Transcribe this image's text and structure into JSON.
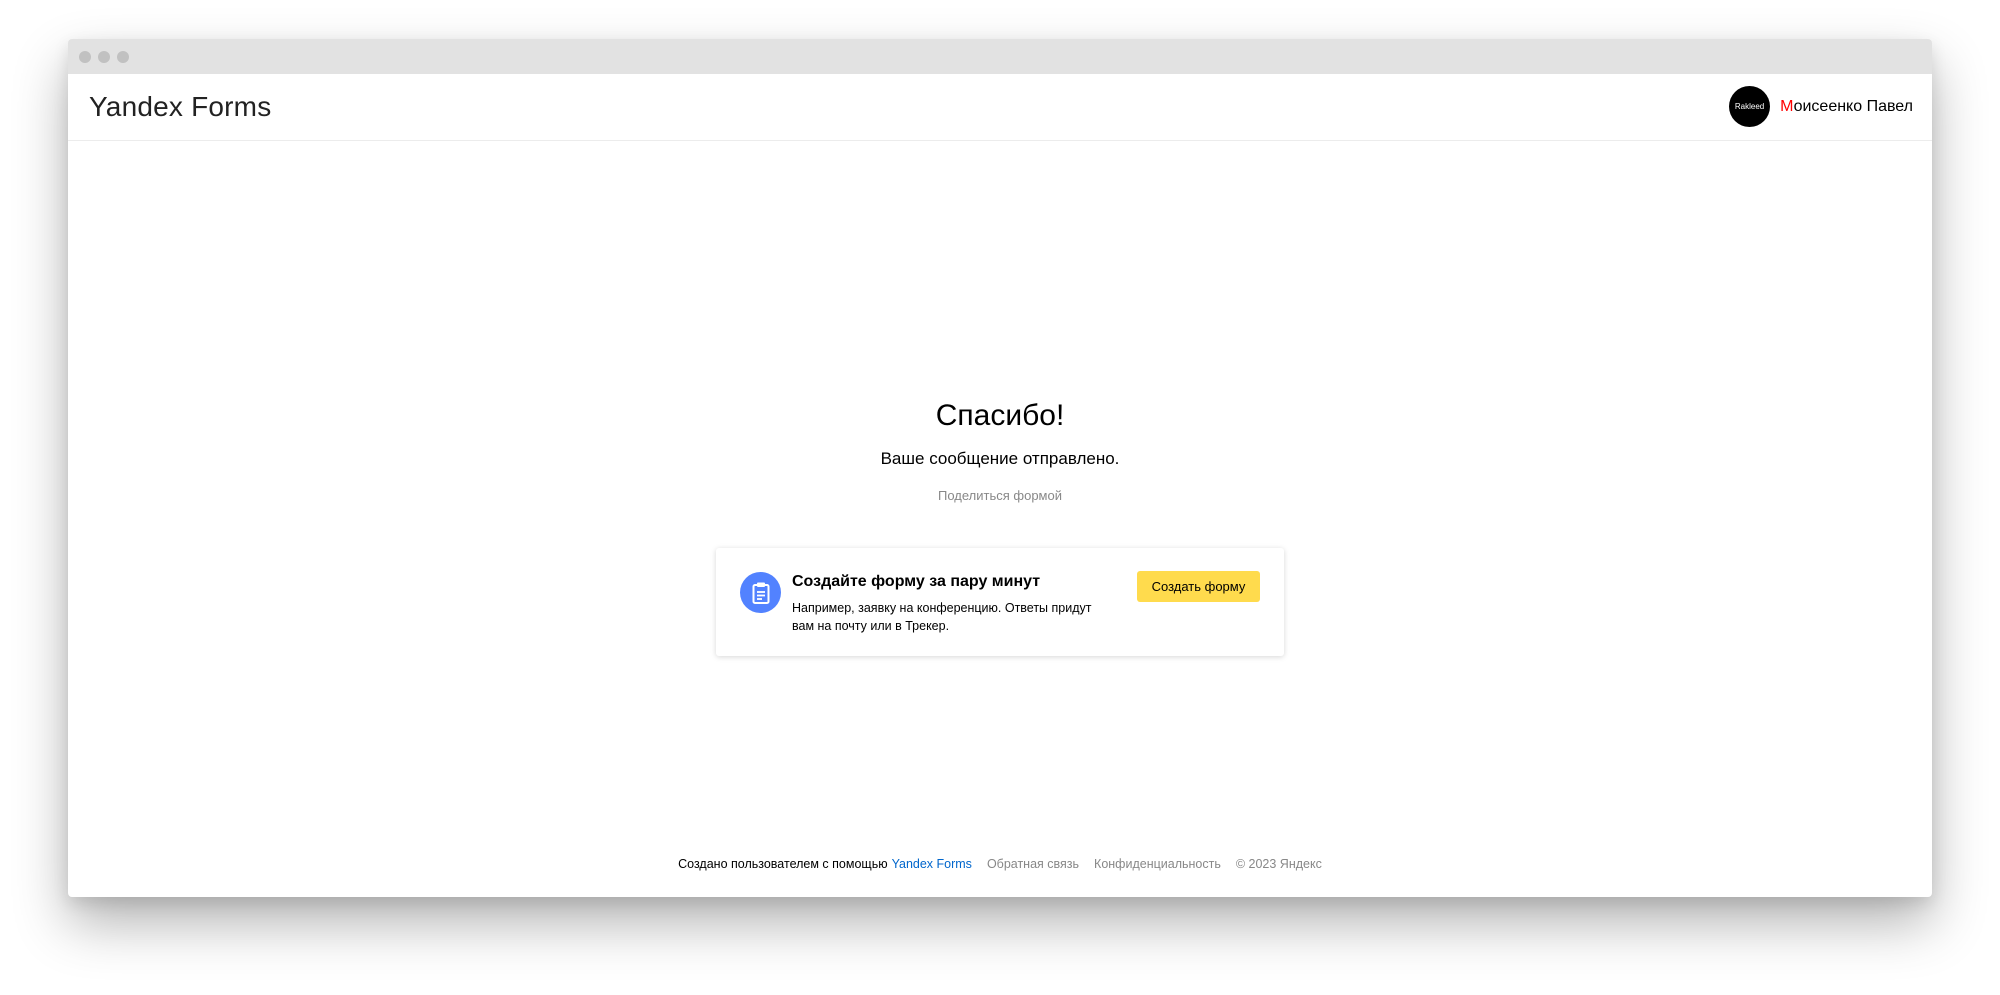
{
  "header": {
    "logo": "Yandex Forms",
    "user": {
      "avatar_text": "Rakleed",
      "name_first": "М",
      "name_rest": "оисеенко Павел"
    }
  },
  "main": {
    "title": "Спасибо!",
    "subtitle": "Ваше сообщение отправлено.",
    "share_link": "Поделиться формой"
  },
  "promo": {
    "icon": "clipboard-icon",
    "title": "Создайте форму за пару минут",
    "text": "Например, заявку на конференцию. Ответы придут вам на почту или в Трекер.",
    "button": "Создать форму"
  },
  "footer": {
    "made_with": "Создано пользователем с помощью",
    "brand_link": "Yandex Forms",
    "feedback": "Обратная связь",
    "privacy": "Конфиденциальность",
    "copyright": "© 2023  Яндекс"
  },
  "colors": {
    "accent_button": "#ffdb4d",
    "icon_circle": "#5282ff",
    "link": "#0066cc",
    "name_accent": "#ff0000"
  }
}
